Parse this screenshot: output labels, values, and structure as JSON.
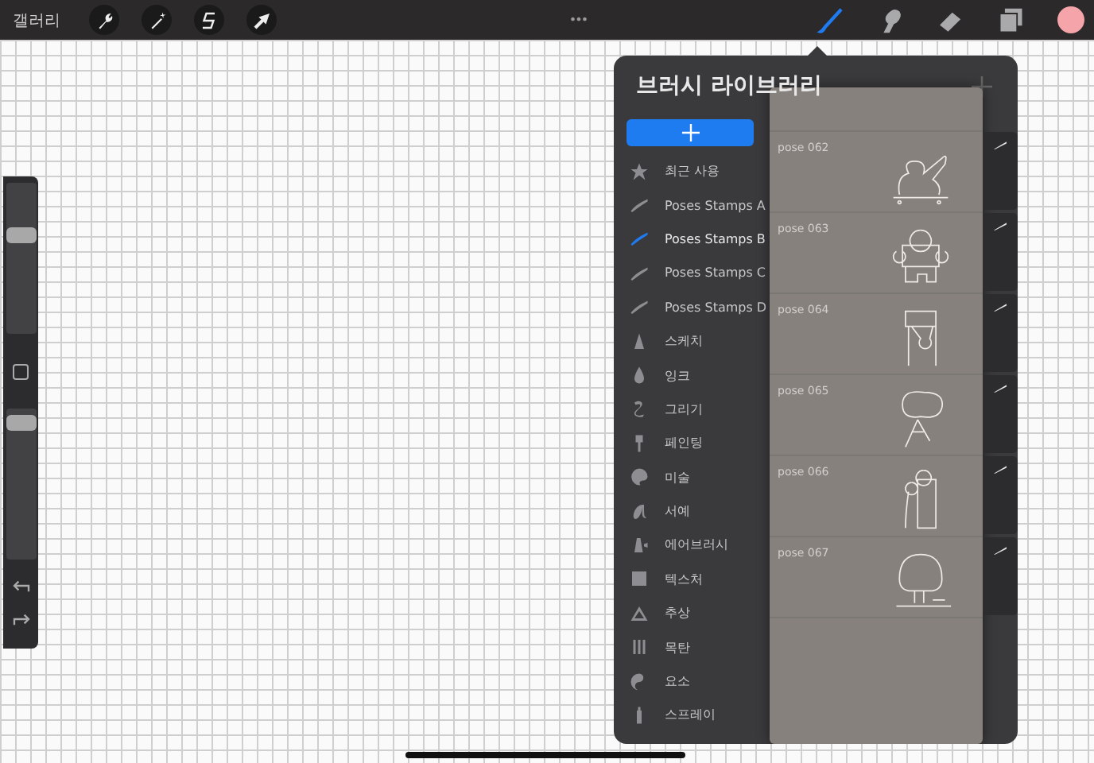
{
  "top_bar": {
    "gallery": "갤러리",
    "more": "•••",
    "actions": [
      {
        "kind": "wrench"
      },
      {
        "kind": "wand"
      },
      {
        "kind": "select"
      },
      {
        "kind": "move"
      }
    ],
    "tools": [
      {
        "kind": "brush",
        "selected": true
      },
      {
        "kind": "smudge",
        "selected": false
      },
      {
        "kind": "eraser",
        "selected": false
      },
      {
        "kind": "layers",
        "selected": false
      }
    ],
    "color": "#f5a5aa"
  },
  "sidebar": {
    "brush_size": {
      "level": 0.67
    },
    "opacity": {
      "level": 0.95
    }
  },
  "brush_library": {
    "title": "브러시 라이브러리",
    "sets": [
      {
        "name": "최근 사용",
        "selected": false
      },
      {
        "name": "Poses Stamps A",
        "selected": false
      },
      {
        "name": "Poses Stamps B",
        "selected": true
      },
      {
        "name": "Poses Stamps C",
        "selected": false
      },
      {
        "name": "Poses Stamps D",
        "selected": false
      },
      {
        "name": "스케치",
        "selected": false
      },
      {
        "name": "잉크",
        "selected": false
      },
      {
        "name": "그리기",
        "selected": false
      },
      {
        "name": "페인팅",
        "selected": false
      },
      {
        "name": "미술",
        "selected": false
      },
      {
        "name": "서예",
        "selected": false
      },
      {
        "name": "에어브러시",
        "selected": false
      },
      {
        "name": "텍스처",
        "selected": false
      },
      {
        "name": "추상",
        "selected": false
      },
      {
        "name": "목탄",
        "selected": false
      },
      {
        "name": "요소",
        "selected": false
      },
      {
        "name": "스프레이",
        "selected": false
      }
    ],
    "brushes": [
      {
        "name": "pose 062"
      },
      {
        "name": "pose 063"
      },
      {
        "name": "pose 064"
      },
      {
        "name": "pose 065"
      },
      {
        "name": "pose 066"
      },
      {
        "name": "pose 067"
      }
    ]
  }
}
